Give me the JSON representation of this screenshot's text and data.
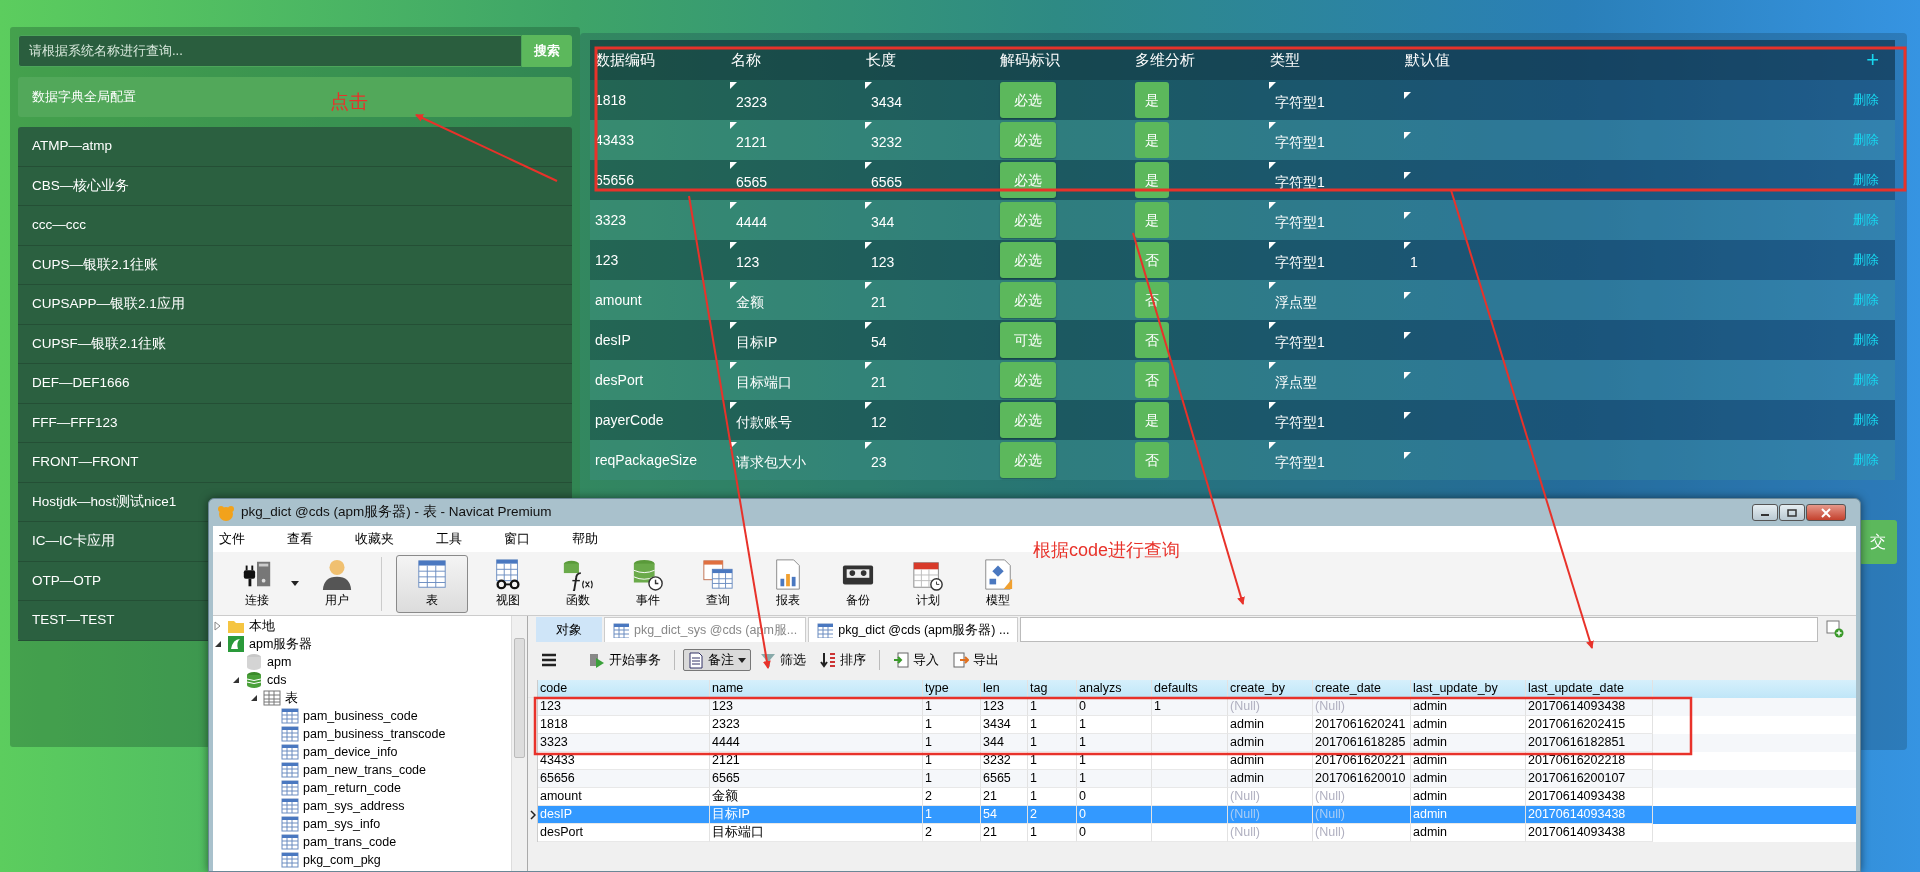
{
  "search": {
    "placeholder": "请根据系统名称进行查询...",
    "button": "搜索"
  },
  "global_config": {
    "label": "数据字典全局配置"
  },
  "systems": [
    {
      "label": "ATMP—atmp"
    },
    {
      "label": "CBS—核心业务"
    },
    {
      "label": "ccc—ccc"
    },
    {
      "label": "CUPS—银联2.1往账"
    },
    {
      "label": "CUPSAPP—银联2.1应用"
    },
    {
      "label": "CUPSF—银联2.1往账"
    },
    {
      "label": "DEF—DEF1666"
    },
    {
      "label": "FFF—FFF123"
    },
    {
      "label": "FRONT—FRONT"
    },
    {
      "label": "Hostjdk—host测试nice1"
    },
    {
      "label": "IC—IC卡应用"
    },
    {
      "label": "OTP—OTP"
    },
    {
      "label": "TEST—TEST"
    }
  ],
  "dict_table": {
    "columns": [
      "数据编码",
      "名称",
      "长度",
      "解码标识",
      "多维分析",
      "类型",
      "默认值"
    ],
    "add_button": "+",
    "rows": [
      {
        "code": "1818",
        "name": "2323",
        "length": "3434",
        "decode_flag": "必选",
        "multi_analysis": "是",
        "type": "字符型1",
        "delete": "删除"
      },
      {
        "code": "43433",
        "name": "2121",
        "length": "3232",
        "decode_flag": "必选",
        "multi_analysis": "是",
        "type": "字符型1",
        "delete": "删除"
      },
      {
        "code": "65656",
        "name": "6565",
        "length": "6565",
        "decode_flag": "必选",
        "multi_analysis": "是",
        "type": "字符型1",
        "delete": "删除"
      },
      {
        "code": "3323",
        "name": "4444",
        "length": "344",
        "decode_flag": "必选",
        "multi_analysis": "是",
        "type": "字符型1",
        "delete": "删除"
      },
      {
        "code": "123",
        "name": "123",
        "length": "123",
        "decode_flag": "必选",
        "multi_analysis": "否",
        "type": "字符型1",
        "default": "1",
        "delete": "删除"
      },
      {
        "code": "amount",
        "name": "金额",
        "length": "21",
        "decode_flag": "必选",
        "multi_analysis": "否",
        "type": "浮点型",
        "delete": "删除"
      },
      {
        "code": "desIP",
        "name": "目标IP",
        "length": "54",
        "decode_flag": "可选",
        "multi_analysis": "否",
        "type": "字符型1",
        "delete": "删除"
      },
      {
        "code": "desPort",
        "name": "目标端口",
        "length": "21",
        "decode_flag": "必选",
        "multi_analysis": "否",
        "type": "浮点型",
        "delete": "删除"
      },
      {
        "code": "payerCode",
        "name": "付款账号",
        "length": "12",
        "decode_flag": "必选",
        "multi_analysis": "是",
        "type": "字符型1",
        "delete": "删除"
      },
      {
        "code": "reqPackageSize",
        "name": "请求包大小",
        "length": "23",
        "decode_flag": "必选",
        "multi_analysis": "否",
        "type": "字符型1",
        "delete": "删除"
      }
    ]
  },
  "submit_button": "交",
  "annotations": [
    {
      "text": "点击"
    },
    {
      "text": "根据code进行查询"
    }
  ],
  "navicat": {
    "title": "pkg_dict @cds (apm服务器) - 表 - Navicat Premium",
    "menu": [
      "文件",
      "查看",
      "收藏夹",
      "工具",
      "窗口",
      "帮助"
    ],
    "toolbar": [
      {
        "label": "连接",
        "kind": "connect",
        "selected": false
      },
      {
        "label": "用户",
        "kind": "user",
        "selected": false
      },
      {
        "label": "表",
        "kind": "table",
        "selected": true
      },
      {
        "label": "视图",
        "kind": "view",
        "selected": false
      },
      {
        "label": "函数",
        "kind": "function",
        "selected": false
      },
      {
        "label": "事件",
        "kind": "event",
        "selected": false
      },
      {
        "label": "查询",
        "kind": "query",
        "selected": false
      },
      {
        "label": "报表",
        "kind": "report",
        "selected": false
      },
      {
        "label": "备份",
        "kind": "backup",
        "selected": false
      },
      {
        "label": "计划",
        "kind": "schedule",
        "selected": false
      },
      {
        "label": "模型",
        "kind": "model",
        "selected": false
      }
    ],
    "tree": [
      {
        "label": "本地",
        "kind": "folder",
        "expanded": false
      },
      {
        "label": "apm服务器",
        "kind": "server",
        "expanded": true,
        "children": [
          {
            "label": "apm",
            "kind": "database",
            "connected": false
          },
          {
            "label": "cds",
            "kind": "database",
            "connected": true,
            "expanded": true,
            "children": [
              {
                "label": "表",
                "kind": "tables",
                "expanded": true,
                "children": [
                  {
                    "label": "pam_business_code",
                    "kind": "table"
                  },
                  {
                    "label": "pam_business_transcode",
                    "kind": "table"
                  },
                  {
                    "label": "pam_device_info",
                    "kind": "table"
                  },
                  {
                    "label": "pam_new_trans_code",
                    "kind": "table"
                  },
                  {
                    "label": "pam_return_code",
                    "kind": "table"
                  },
                  {
                    "label": "pam_sys_address",
                    "kind": "table"
                  },
                  {
                    "label": "pam_sys_info",
                    "kind": "table"
                  },
                  {
                    "label": "pam_trans_code",
                    "kind": "table"
                  },
                  {
                    "label": "pkg_com_pkg",
                    "kind": "table"
                  }
                ]
              }
            ]
          }
        ]
      }
    ],
    "tabs": [
      {
        "label": "对象",
        "kind": "objects",
        "selected": false
      },
      {
        "label": "pkg_dict_sys @cds (apm服...",
        "kind": "table",
        "selected": false
      },
      {
        "label": "pkg_dict @cds (apm服务器) ...",
        "kind": "table",
        "selected": true
      }
    ],
    "grid_toolbar": [
      {
        "label": "开始事务",
        "kind": "transaction",
        "selected": false
      },
      {
        "label": "备注",
        "kind": "memo",
        "selected": true
      },
      {
        "label": "筛选",
        "kind": "filter",
        "selected": false
      },
      {
        "label": "排序",
        "kind": "sort",
        "selected": false
      },
      {
        "label": "导入",
        "kind": "import",
        "selected": false
      },
      {
        "label": "导出",
        "kind": "export",
        "selected": false
      }
    ],
    "grid": {
      "columns": [
        "code",
        "name",
        "type",
        "len",
        "tag",
        "analyzs",
        "defaults",
        "create_by",
        "create_date",
        "last_update_by",
        "last_update_date"
      ],
      "rows": [
        {
          "selected": false,
          "cells": [
            "123",
            "123",
            "1",
            "123",
            "1",
            "0",
            "1",
            {
              "text": "(Null)",
              "kind": "null"
            },
            {
              "text": "(Null)",
              "kind": "null"
            },
            "admin",
            "20170614093438"
          ]
        },
        {
          "selected": false,
          "cells": [
            "1818",
            "2323",
            "1",
            "3434",
            "1",
            "1",
            null,
            "admin",
            "2017061620241",
            "admin",
            "20170616202415"
          ]
        },
        {
          "selected": false,
          "cells": [
            "3323",
            "4444",
            "1",
            "344",
            "1",
            "1",
            null,
            "admin",
            "2017061618285",
            "admin",
            "20170616182851"
          ]
        },
        {
          "selected": false,
          "cells": [
            "43433",
            "2121",
            "1",
            "3232",
            "1",
            "1",
            null,
            "admin",
            "2017061620221",
            "admin",
            "20170616202218"
          ]
        },
        {
          "selected": false,
          "cells": [
            "65656",
            "6565",
            "1",
            "6565",
            "1",
            "1",
            null,
            "admin",
            "2017061620010",
            "admin",
            "20170616200107"
          ]
        },
        {
          "selected": false,
          "cells": [
            "amount",
            "金额",
            "2",
            "21",
            "1",
            "0",
            null,
            {
              "text": "(Null)",
              "kind": "null"
            },
            {
              "text": "(Null)",
              "kind": "null"
            },
            "admin",
            "20170614093438"
          ]
        },
        {
          "selected": true,
          "cells": [
            "desIP",
            "目标IP",
            "1",
            "54",
            "2",
            "0",
            null,
            {
              "text": "(Null)",
              "kind": "null"
            },
            {
              "text": "(Null)",
              "kind": "null"
            },
            "admin",
            "20170614093438"
          ]
        },
        {
          "selected": false,
          "cells": [
            "desPort",
            "目标端口",
            "2",
            "21",
            "1",
            "0",
            null,
            {
              "text": "(Null)",
              "kind": "null"
            },
            {
              "text": "(Null)",
              "kind": "null"
            },
            "admin",
            "20170614093438"
          ]
        }
      ]
    }
  }
}
